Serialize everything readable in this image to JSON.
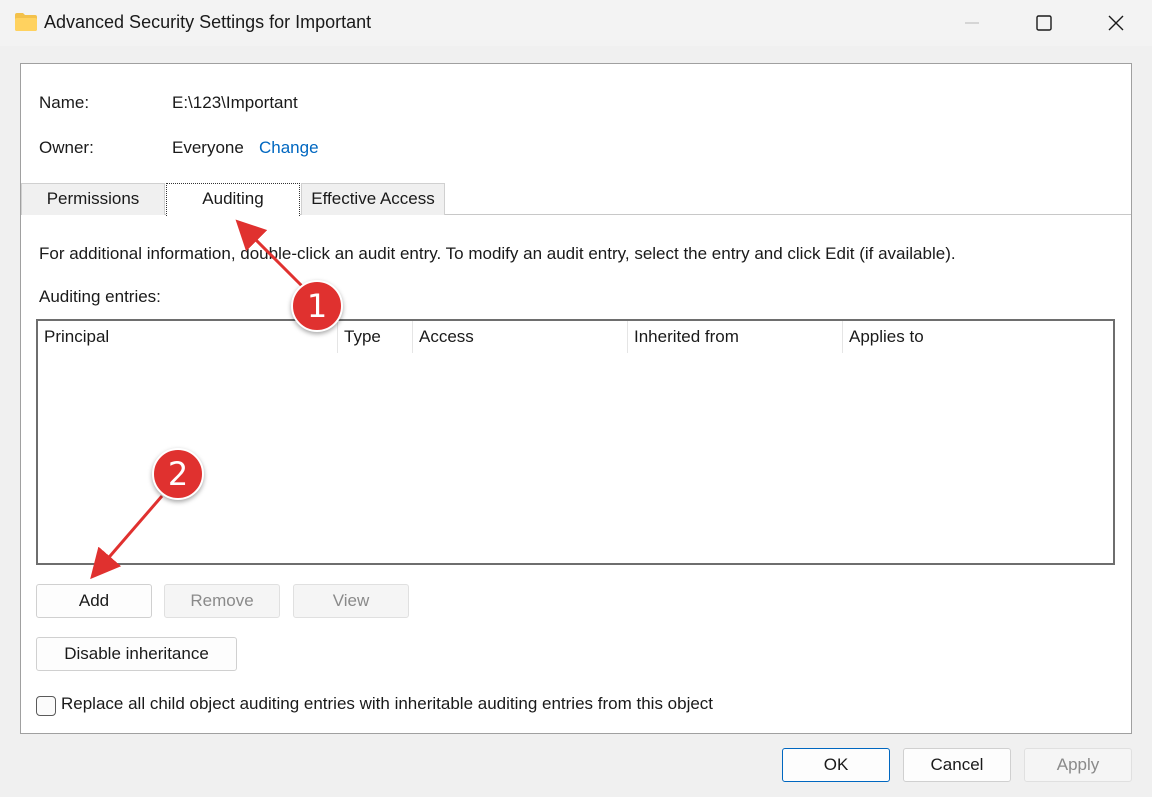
{
  "window": {
    "title": "Advanced Security Settings for Important",
    "icons": {
      "app": "folder-icon",
      "minimize": "minimize-icon",
      "maximize": "maximize-icon",
      "close": "close-icon"
    }
  },
  "object": {
    "name_label": "Name:",
    "name_value": "E:\\123\\Important",
    "owner_label": "Owner:",
    "owner_value": "Everyone",
    "change_link": "Change"
  },
  "tabs": [
    {
      "label": "Permissions",
      "selected": false
    },
    {
      "label": "Auditing",
      "selected": true
    },
    {
      "label": "Effective Access",
      "selected": false
    }
  ],
  "auditing": {
    "info": "For additional information, double-click an audit entry. To modify an audit entry, select the entry and click Edit (if available).",
    "entries_label": "Auditing entries:",
    "columns": [
      "Principal",
      "Type",
      "Access",
      "Inherited from",
      "Applies to"
    ],
    "rows": []
  },
  "buttons": {
    "add": "Add",
    "remove": "Remove",
    "view": "View",
    "disable_inheritance": "Disable inheritance",
    "ok": "OK",
    "cancel": "Cancel",
    "apply": "Apply"
  },
  "checkbox": {
    "label": "Replace all child object auditing entries with inheritable auditing entries from this object",
    "checked": false
  },
  "annotations": [
    {
      "number": "1"
    },
    {
      "number": "2"
    }
  ],
  "colors": {
    "accent": "#0067c0",
    "annotation": "#e0312f",
    "link": "#0067c0"
  }
}
